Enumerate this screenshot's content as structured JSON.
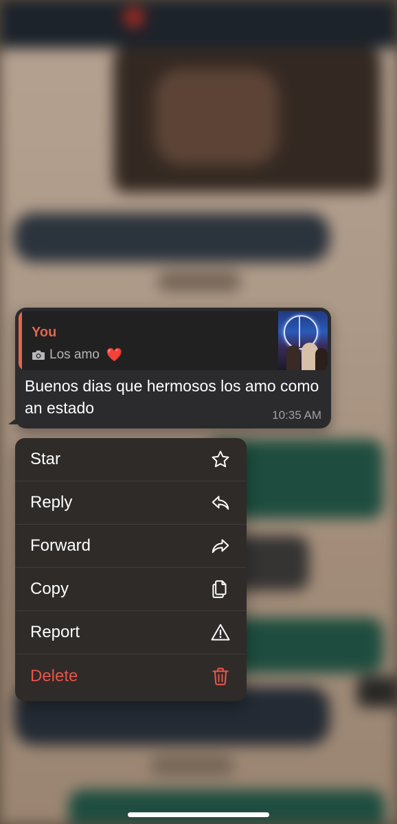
{
  "message": {
    "quoted": {
      "author": "You",
      "caption": "Los amo",
      "media_icon": "camera-icon",
      "emoji": "❤️",
      "thumbnail": "photo-thumbnail"
    },
    "text": "Buenos dias que hermosos los amo como an estado",
    "time": "10:35 AM"
  },
  "menu": {
    "items": [
      {
        "label": "Star",
        "icon": "star-icon"
      },
      {
        "label": "Reply",
        "icon": "reply-icon"
      },
      {
        "label": "Forward",
        "icon": "forward-icon"
      },
      {
        "label": "Copy",
        "icon": "copy-icon"
      },
      {
        "label": "Report",
        "icon": "warning-icon"
      },
      {
        "label": "Delete",
        "icon": "trash-icon"
      }
    ]
  },
  "colors": {
    "accent_quote": "#e2664c",
    "delete": "#e8554a",
    "bubble": "#2b2b2d",
    "menu_bg": "#2e2b29"
  }
}
